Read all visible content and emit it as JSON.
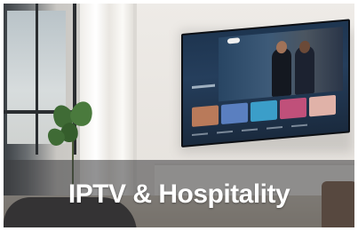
{
  "card": {
    "caption": "IPTV & Hospitality"
  },
  "colors": {
    "banner_overlay": "#3a3a3c",
    "caption_text": "#ffffff",
    "wall": "#eeebe7",
    "tv_screen": "#1e3550"
  },
  "image": {
    "subject": "wall-mounted smart TV in a hotel room",
    "icons": [
      "tv-icon"
    ]
  }
}
